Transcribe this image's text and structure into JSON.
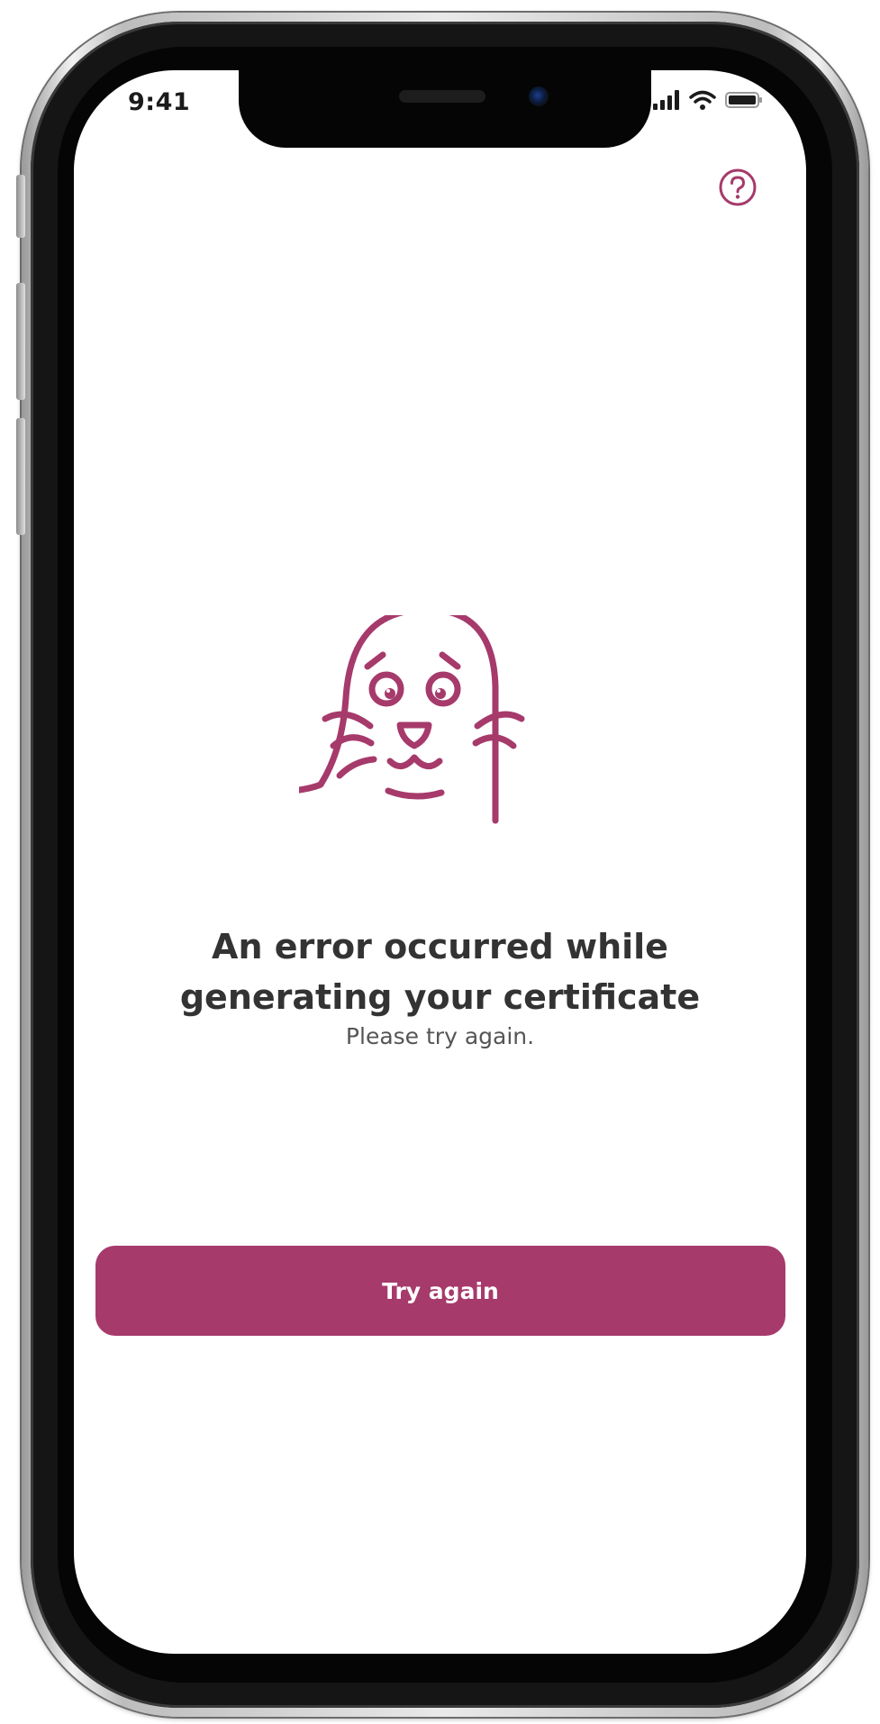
{
  "status_bar": {
    "time": "9:41",
    "icons": [
      "cellular-signal-icon",
      "wifi-icon",
      "battery-icon"
    ]
  },
  "header": {
    "help_icon": "question-circle-icon"
  },
  "illustration": {
    "icon": "sad-seal-icon"
  },
  "error": {
    "title": "An error occurred while\ngenerating your certificate",
    "subtitle": "Please try again."
  },
  "actions": {
    "try_again_label": "Try again"
  },
  "colors": {
    "accent": "#a63a6b",
    "title_text": "#333333",
    "subtitle_text": "#555555",
    "background": "#ffffff"
  }
}
